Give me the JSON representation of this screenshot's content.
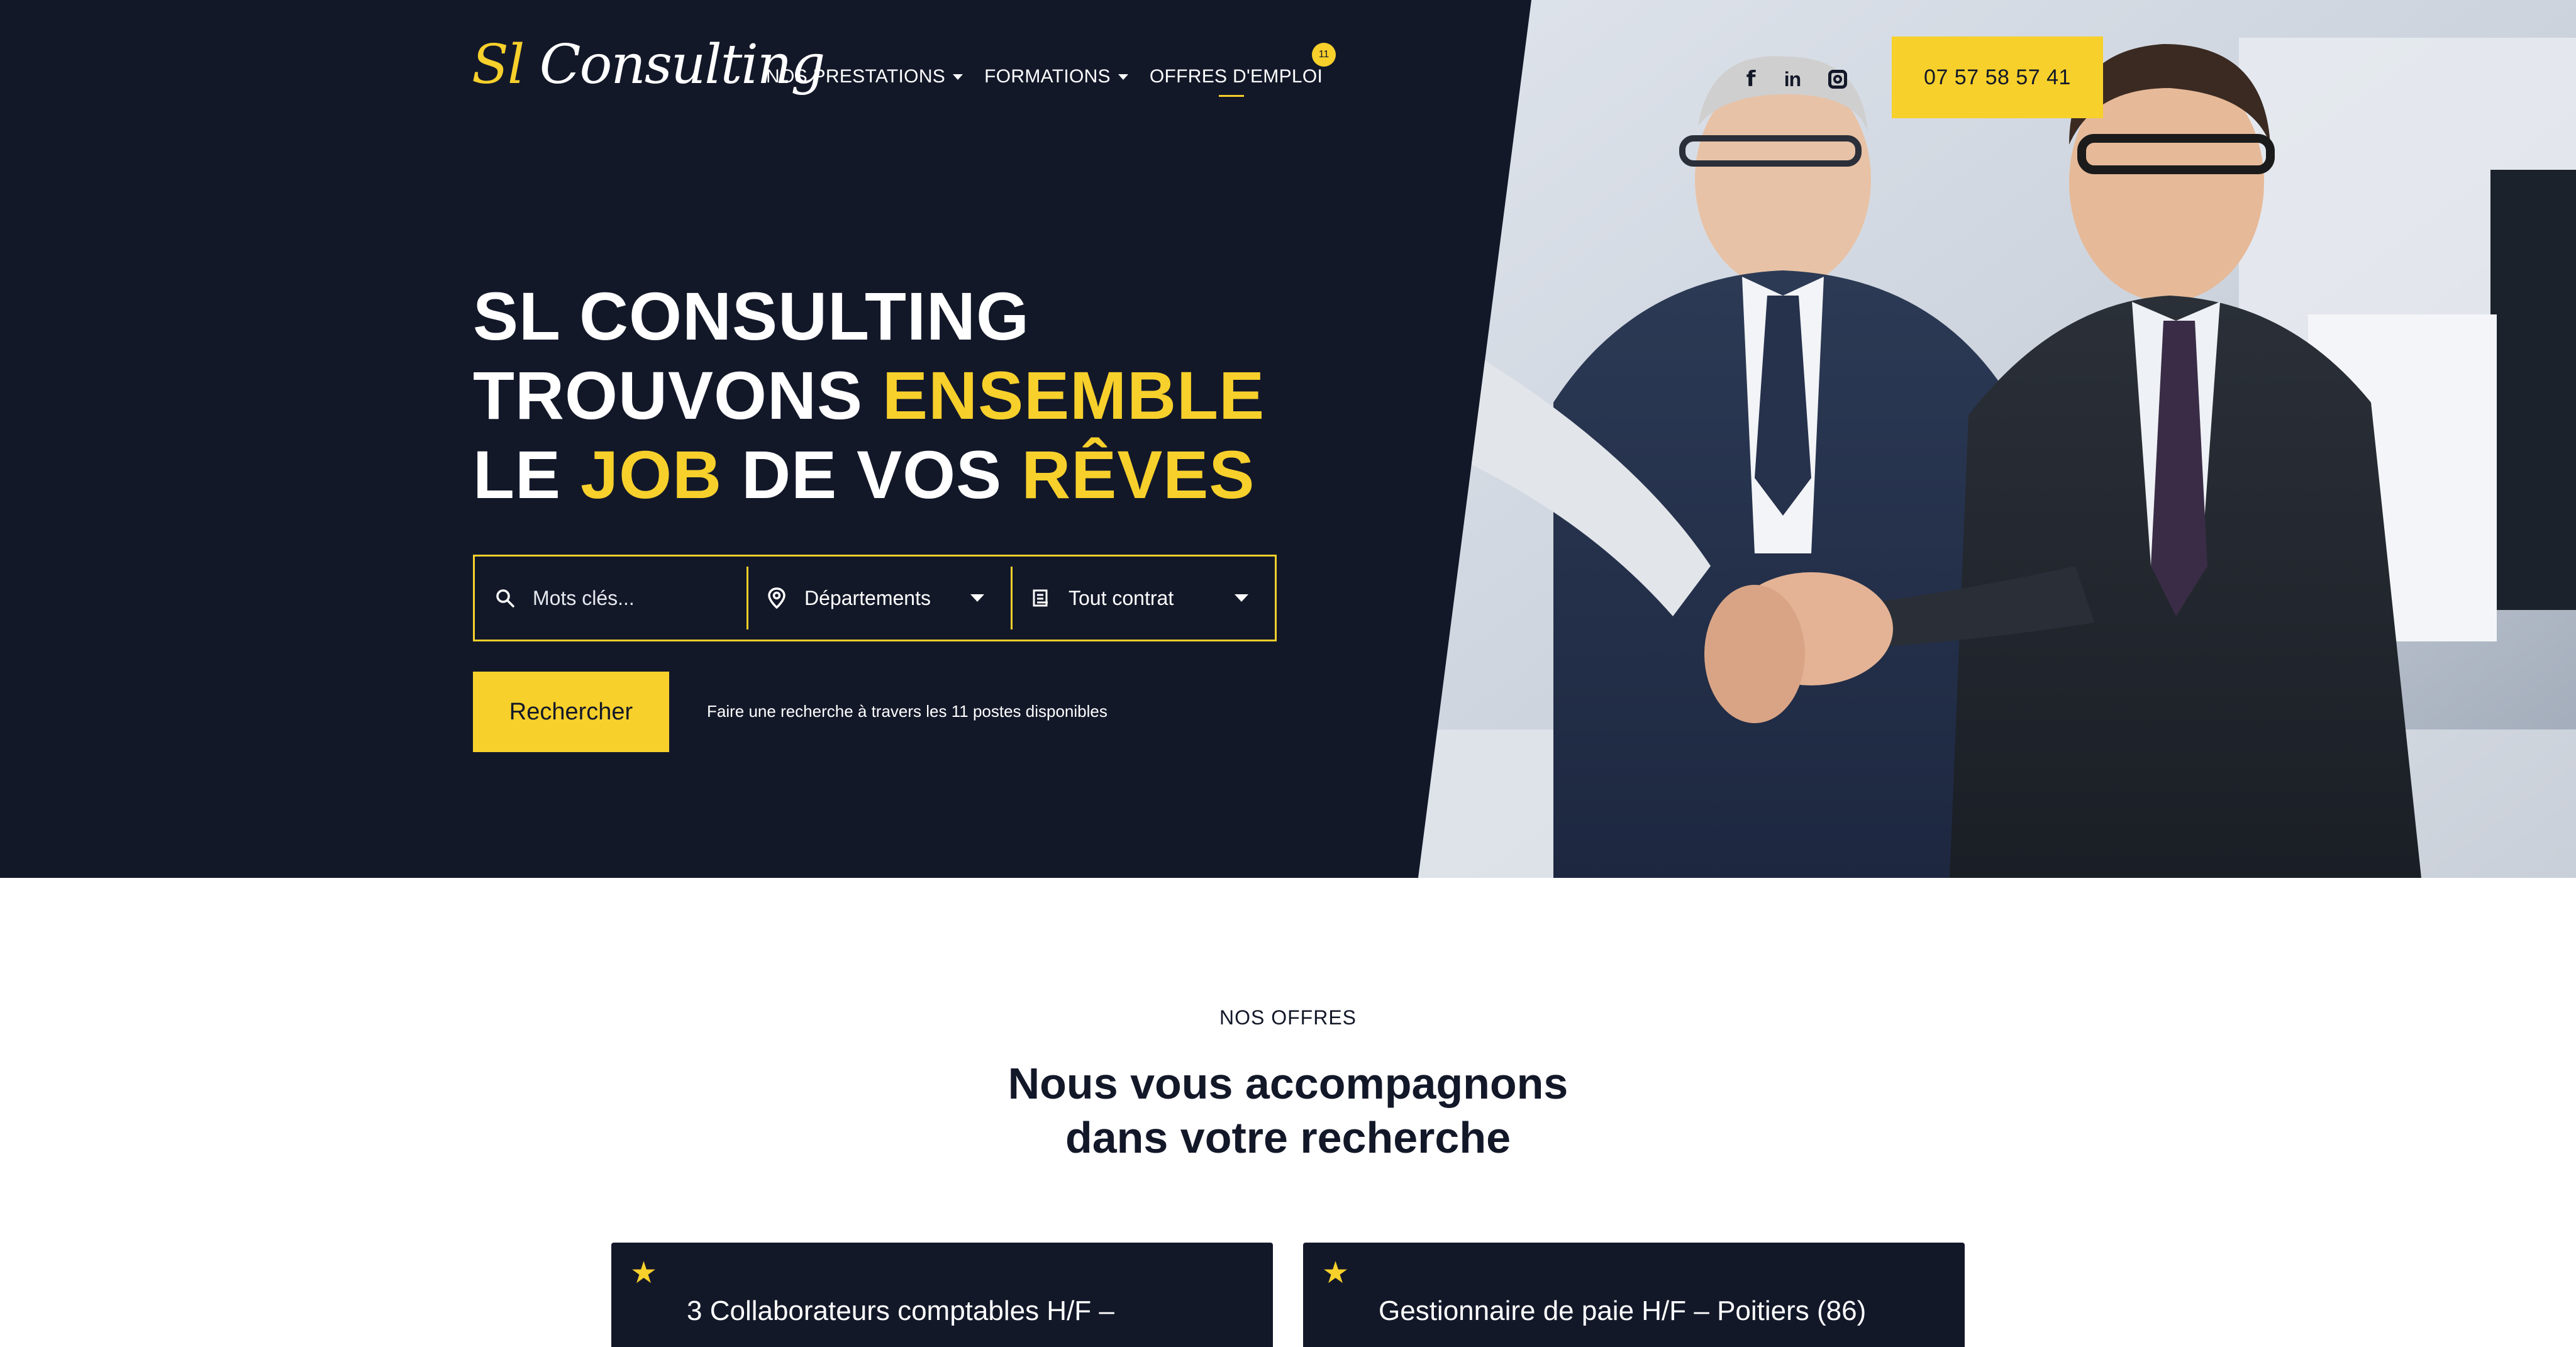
{
  "brand": {
    "logo_part1": "Sl",
    "logo_part2": "Consulting"
  },
  "nav": {
    "items": [
      {
        "label": "NOS PRESTATIONS"
      },
      {
        "label": "FORMATIONS"
      },
      {
        "label": "OFFRES D'EMPLOI"
      }
    ],
    "jobs_badge": "11"
  },
  "social": {
    "icons": [
      "facebook-icon",
      "linkedin-icon",
      "instagram-icon"
    ]
  },
  "header": {
    "phone": "07 57 58 57 41"
  },
  "hero": {
    "line1": "SL CONSULTING",
    "line2_a": "TROUVONS ",
    "line2_b": "ENSEMBLE",
    "line3_a": "LE ",
    "line3_b": "JOB",
    "line3_c": " DE VOS ",
    "line3_d": "RÊVES"
  },
  "search": {
    "keywords_placeholder": "Mots clés...",
    "department_selected": "Départements",
    "contract_selected": "Tout contrat",
    "button_label": "Rechercher",
    "hint": "Faire une recherche à travers les 11 postes disponibles"
  },
  "offers": {
    "eyebrow": "NOS OFFRES",
    "title_line1": "Nous vous accompagnons",
    "title_line2": "dans votre recherche",
    "cards": [
      {
        "title": "3 Collaborateurs comptables H/F –"
      },
      {
        "title": "Gestionnaire de paie H/F – Poitiers (86)"
      }
    ]
  },
  "colors": {
    "navy": "#131829",
    "accent": "#f7d02b",
    "white": "#ffffff"
  }
}
